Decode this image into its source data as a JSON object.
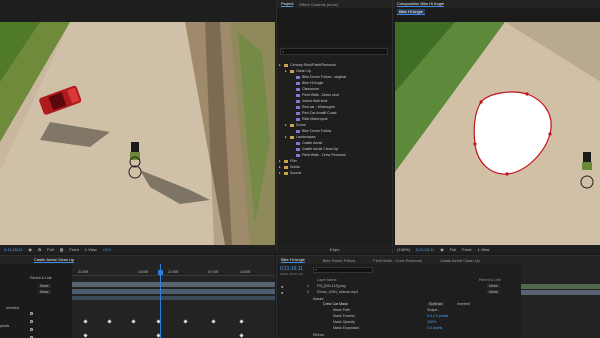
{
  "footage_panel": {
    "timecode": "0;11;16;11",
    "quality": "Full",
    "view": "Front",
    "views": "1 View",
    "exposure": "+0.0"
  },
  "project_panel": {
    "tab_project": "Project",
    "tab_effect_controls": "Effect Controls (none)",
    "search_icon": "search-icon",
    "tree": [
      {
        "label": "Century Roto/Paint/Removal",
        "level": 0,
        "kind": "folder"
      },
      {
        "label": "Clean Up",
        "level": 1,
        "kind": "folder"
      },
      {
        "label": "Bike Drone Follow - original",
        "level": 2,
        "kind": "comp"
      },
      {
        "label": "Bike Hi Angle",
        "level": 2,
        "kind": "comp"
      },
      {
        "label": "Classroom",
        "level": 2,
        "kind": "comp"
      },
      {
        "label": "Field Walk - Down shot",
        "level": 2,
        "kind": "comp"
      },
      {
        "label": "Inland Wall shot",
        "level": 2,
        "kind": "comp"
      },
      {
        "label": "Red car - Motorcycle",
        "level": 2,
        "kind": "comp"
      },
      {
        "label": "Red Car Amalfi Coast",
        "level": 2,
        "kind": "comp"
      },
      {
        "label": "Ride Motorcycle",
        "level": 2,
        "kind": "comp"
      },
      {
        "label": "Drone",
        "level": 1,
        "kind": "folder"
      },
      {
        "label": "Bike Drone Follow",
        "level": 2,
        "kind": "comp"
      },
      {
        "label": "Landscapes",
        "level": 1,
        "kind": "folder"
      },
      {
        "label": "Castle Aerial",
        "level": 2,
        "kind": "comp"
      },
      {
        "label": "Castle Aerial Clean Up",
        "level": 2,
        "kind": "comp"
      },
      {
        "label": "Field Walk - Crew Removal",
        "level": 2,
        "kind": "comp"
      },
      {
        "label": "Film",
        "level": 0,
        "kind": "folder"
      },
      {
        "label": "Solids",
        "level": 0,
        "kind": "folder"
      },
      {
        "label": "Source",
        "level": 0,
        "kind": "folder"
      }
    ],
    "bpc": "8 bpc"
  },
  "composition_panel": {
    "tab": "Composition Bike Hi Angle",
    "sub_tab": "Bike Hi Angle",
    "zoom": "(136%)",
    "timecode": "0;11;16;11",
    "quality": "Full",
    "view": "Front",
    "views": "1 View"
  },
  "timeline_left": {
    "tab": "Castle Aerial Clean Up",
    "rows": [
      {
        "label": "Parent & Link"
      },
      {
        "label": "None"
      },
      {
        "label": "None"
      }
    ],
    "ruler": [
      "21:00f",
      "14:00f",
      "21:00f",
      "07:00f",
      "14:00f"
    ],
    "side_labels": [
      "Inverted",
      "pixels"
    ]
  },
  "timeline_right": {
    "tabs": [
      "Bike Hi Angle",
      "Bike Drone Follow",
      "Field Walk - Crew Removal",
      "Castle Aerial Clean Up"
    ],
    "timecode": "0;11;16;11",
    "frames": "00311 (29.97 fps)",
    "columns": {
      "layer_name": "Layer Name",
      "parent": "Parent & Link"
    },
    "layers": [
      {
        "num": "1",
        "name": "Fill_[000-119].png",
        "parent": "None"
      },
      {
        "num": "2",
        "name": "Drone_0494_selects.mp4",
        "parent": "None"
      }
    ],
    "masks_label": "Masks",
    "mask_name": "Crew Car Mask",
    "mask_mode": "Subtract",
    "mask_inverted": "Inverted",
    "mask_props": [
      {
        "label": "Mask Path",
        "value": "Shape..."
      },
      {
        "label": "Mask Feather",
        "value": "0.0,0.0 pixels"
      },
      {
        "label": "Mask Opacity",
        "value": "100%"
      },
      {
        "label": "Mask Expansion",
        "value": "0.0 pixels"
      }
    ],
    "effects_label": "Effects"
  }
}
